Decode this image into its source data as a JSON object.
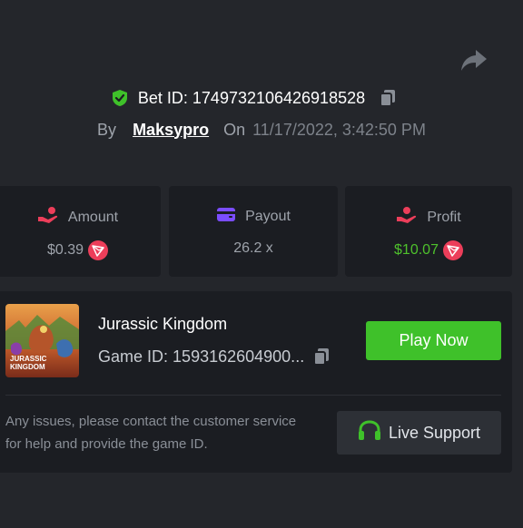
{
  "bet": {
    "prefix": "Bet ID:",
    "id": "1749732106426918528",
    "by_label": "By",
    "username": "Maksypro",
    "on_label": "On",
    "datetime": "11/17/2022, 3:42:50 PM"
  },
  "stats": [
    {
      "label": "Amount",
      "value": "$0.39",
      "icon": "hand-coin-icon",
      "currency_icon": "tron-icon"
    },
    {
      "label": "Payout",
      "value": "26.2 x",
      "icon": "wallet-icon"
    },
    {
      "label": "Profit",
      "value": "$10.07",
      "icon": "hand-coin-icon",
      "currency_icon": "tron-icon",
      "value_color": "#4ec02c"
    }
  ],
  "game": {
    "title": "Jurassic Kingdom",
    "id_label": "Game ID:",
    "id_value": "1593162604900...",
    "thumbnail_text": "JURASSIC KINGDOM",
    "play_label": "Play Now"
  },
  "support": {
    "message": "Any issues, please contact the customer service for help and provide the game ID.",
    "button_label": "Live Support"
  },
  "colors": {
    "background": "#24262b",
    "card": "#1b1d22",
    "accent_green": "#3fc12a",
    "profit_green": "#4ec02c",
    "tron_red": "#ec3e5a",
    "payout_purple": "#7b4dff"
  }
}
